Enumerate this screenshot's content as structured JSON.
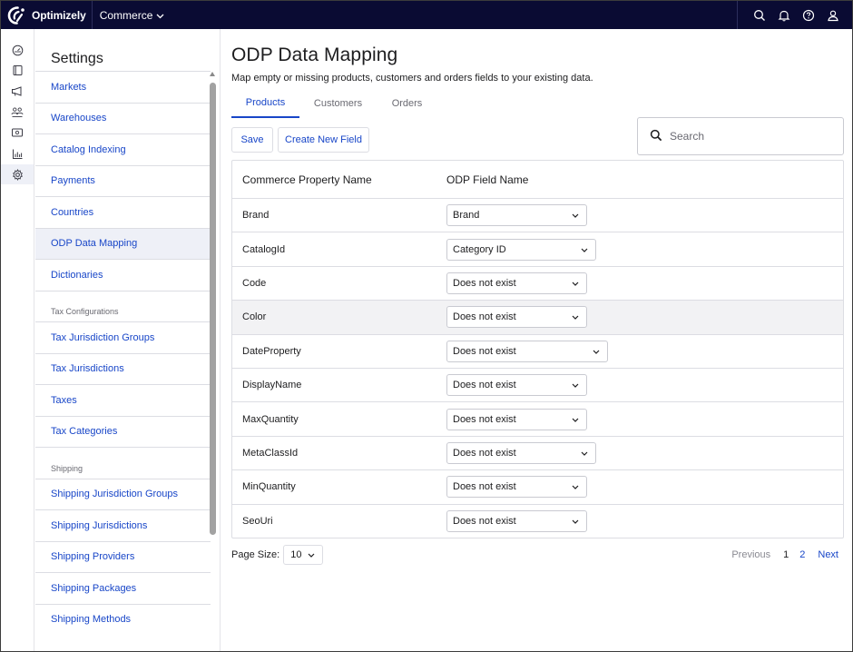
{
  "topbar": {
    "brand_name": "Optimizely",
    "product": "Commerce",
    "icons": [
      "search-icon",
      "bell-icon",
      "help-icon",
      "user-icon"
    ]
  },
  "rail": {
    "icons": [
      "dashboard-icon",
      "content-icon",
      "marketing-icon",
      "customers-icon",
      "orders-icon",
      "reports-icon",
      "settings-icon"
    ],
    "active": "settings-icon"
  },
  "settings": {
    "title": "Settings",
    "items": [
      {
        "type": "link",
        "label": "Markets"
      },
      {
        "type": "link",
        "label": "Warehouses"
      },
      {
        "type": "link",
        "label": "Catalog Indexing"
      },
      {
        "type": "link",
        "label": "Payments"
      },
      {
        "type": "link",
        "label": "Countries"
      },
      {
        "type": "link",
        "label": "ODP Data Mapping",
        "active": true
      },
      {
        "type": "link",
        "label": "Dictionaries"
      },
      {
        "type": "group",
        "label": "Tax Configurations"
      },
      {
        "type": "link",
        "label": "Tax Jurisdiction Groups"
      },
      {
        "type": "link",
        "label": "Tax Jurisdictions"
      },
      {
        "type": "link",
        "label": "Taxes"
      },
      {
        "type": "link",
        "label": "Tax Categories"
      },
      {
        "type": "group",
        "label": "Shipping"
      },
      {
        "type": "link",
        "label": "Shipping Jurisdiction Groups"
      },
      {
        "type": "link",
        "label": "Shipping Jurisdictions"
      },
      {
        "type": "link",
        "label": "Shipping Providers"
      },
      {
        "type": "link",
        "label": "Shipping Packages"
      },
      {
        "type": "link",
        "label": "Shipping Methods"
      }
    ]
  },
  "main": {
    "title": "ODP Data Mapping",
    "subtitle": "Map empty or missing products, customers and orders fields to your existing data.",
    "tabs": [
      {
        "label": "Products",
        "active": true
      },
      {
        "label": "Customers"
      },
      {
        "label": "Orders"
      }
    ],
    "save_label": "Save",
    "create_label": "Create New Field",
    "search_placeholder": "Search",
    "columns": [
      "Commerce Property Name",
      "ODP Field Name"
    ],
    "rows": [
      {
        "property": "Brand",
        "field": "Brand",
        "w": "wide0"
      },
      {
        "property": "CatalogId",
        "field": "Category ID",
        "w": "wide1"
      },
      {
        "property": "Code",
        "field": "Does not exist",
        "w": "wide0"
      },
      {
        "property": "Color",
        "field": "Does not exist",
        "w": "wide0",
        "hover": true
      },
      {
        "property": "DateProperty",
        "field": "Does not exist",
        "w": "wide2"
      },
      {
        "property": "DisplayName",
        "field": "Does not exist",
        "w": "wide0"
      },
      {
        "property": "MaxQuantity",
        "field": "Does not exist",
        "w": "wide0"
      },
      {
        "property": "MetaClassId",
        "field": "Does not exist",
        "w": "wide1"
      },
      {
        "property": "MinQuantity",
        "field": "Does not exist",
        "w": "wide0"
      },
      {
        "property": "SeoUri",
        "field": "Does not exist",
        "w": "wide0"
      }
    ],
    "page_size_label": "Page Size:",
    "page_size": "10",
    "pager": {
      "previous": "Previous",
      "pages": [
        "1",
        "2"
      ],
      "current": "1",
      "next": "Next"
    }
  }
}
